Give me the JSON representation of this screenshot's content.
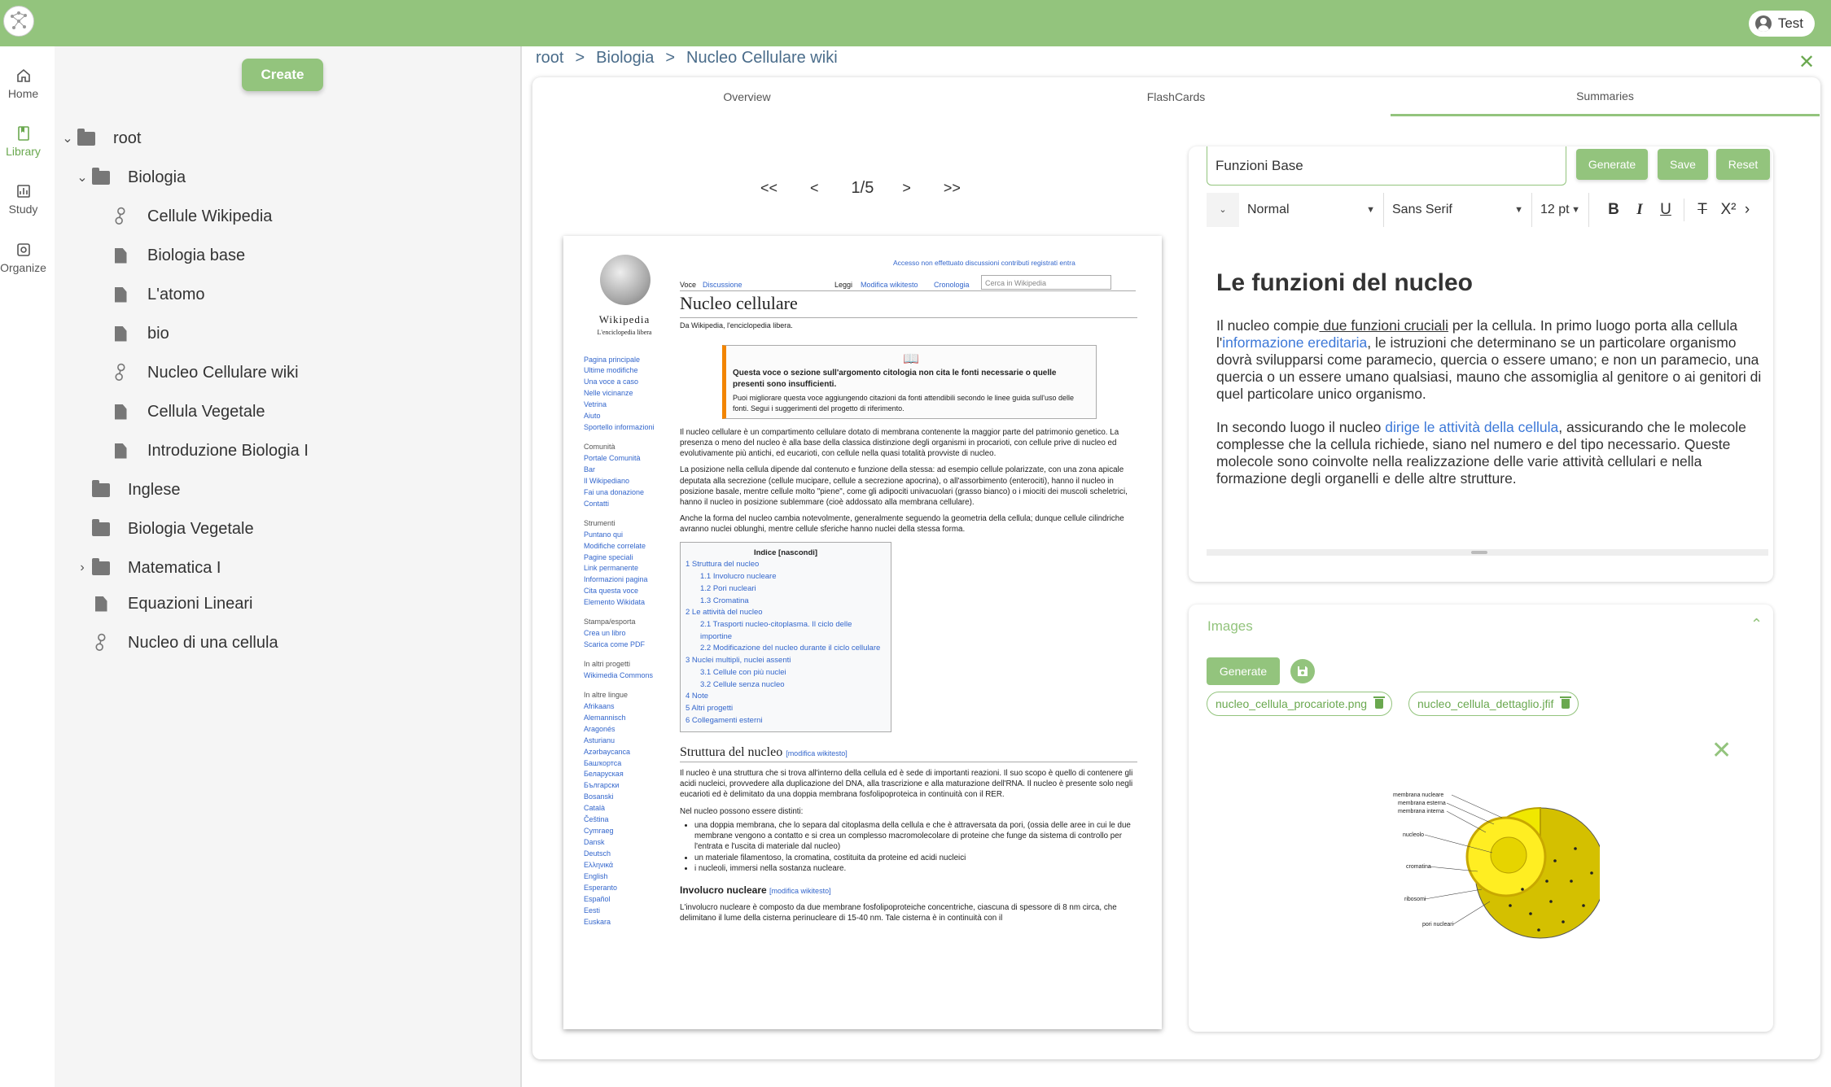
{
  "app": {
    "user_label": "Test"
  },
  "nav": [
    {
      "label": "Home",
      "icon": "home-icon"
    },
    {
      "label": "Library",
      "icon": "library-icon"
    },
    {
      "label": "Study",
      "icon": "study-icon"
    },
    {
      "label": "Organize",
      "icon": "organize-icon"
    }
  ],
  "sidebar": {
    "create_label": "Create",
    "tree": [
      {
        "label": "root",
        "type": "folder",
        "expanded": true
      },
      {
        "label": "Biologia",
        "type": "folder",
        "expanded": true
      },
      {
        "label": "Cellule Wikipedia",
        "type": "link"
      },
      {
        "label": "Biologia base",
        "type": "document"
      },
      {
        "label": "L'atomo",
        "type": "document"
      },
      {
        "label": "bio",
        "type": "document"
      },
      {
        "label": "Nucleo Cellulare wiki",
        "type": "link"
      },
      {
        "label": "Cellula Vegetale",
        "type": "document"
      },
      {
        "label": "Introduzione Biologia I",
        "type": "document"
      },
      {
        "label": "Inglese",
        "type": "folder"
      },
      {
        "label": "Biologia Vegetale",
        "type": "folder"
      },
      {
        "label": "Matematica I",
        "type": "folder",
        "expanded": false
      },
      {
        "label": "Equazioni Lineari",
        "type": "document"
      },
      {
        "label": "Nucleo di una cellula",
        "type": "link"
      }
    ]
  },
  "breadcrumb": {
    "items": [
      "root",
      "Biologia",
      "Nucleo Cellulare wiki"
    ],
    "separator": ">"
  },
  "tabs": [
    {
      "label": "Overview",
      "active": false
    },
    {
      "label": "FlashCards",
      "active": false
    },
    {
      "label": "Summaries",
      "active": true
    }
  ],
  "pager": {
    "first": "<<",
    "prev": "<",
    "current": "1/5",
    "next": ">",
    "last": ">>"
  },
  "document": {
    "top_links": "Accesso non effettuato  discussioni  contributi  registrati  entra",
    "tabs_left": [
      "Voce",
      "Discussione"
    ],
    "tabs_right": [
      "Leggi",
      "Modifica wikitesto",
      "Cronologia"
    ],
    "search_placeholder": "Cerca in Wikipedia",
    "logo_title": "Wikipedia",
    "logo_subtitle": "L'enciclopedia libera",
    "sidebar_links": [
      "Pagina principale",
      "Ultime modifiche",
      "Una voce a caso",
      "Nelle vicinanze",
      "Vetrina",
      "Aiuto",
      "Sportello informazioni"
    ],
    "sidebar_community_title": "Comunità",
    "sidebar_community": [
      "Portale Comunità",
      "Bar",
      "Il Wikipediano",
      "Fai una donazione",
      "Contatti"
    ],
    "sidebar_tools_title": "Strumenti",
    "sidebar_tools": [
      "Puntano qui",
      "Modifiche correlate",
      "Pagine speciali",
      "Link permanente",
      "Informazioni pagina",
      "Cita questa voce",
      "Elemento Wikidata"
    ],
    "sidebar_print_title": "Stampa/esporta",
    "sidebar_print": [
      "Crea un libro",
      "Scarica come PDF"
    ],
    "sidebar_projects_title": "In altri progetti",
    "sidebar_projects": [
      "Wikimedia Commons"
    ],
    "sidebar_lang_title": "In altre lingue",
    "sidebar_langs": [
      "Afrikaans",
      "Alemannisch",
      "Aragonés",
      "Asturianu",
      "Azərbaycanca",
      "Башҡортса",
      "Беларуская",
      "Български",
      "Bosanski",
      "Català",
      "Čeština",
      "Cymraeg",
      "Dansk",
      "Deutsch",
      "Ελληνικά",
      "English",
      "Esperanto",
      "Español",
      "Eesti",
      "Euskara"
    ],
    "title": "Nucleo cellulare",
    "from": "Da Wikipedia, l'enciclopedia libera.",
    "notice_bold": "Questa voce o sezione sull'argomento citologia non cita le fonti necessarie o quelle presenti sono insufficienti.",
    "notice_text": "Puoi migliorare questa voce aggiungendo citazioni da fonti attendibili secondo le linee guida sull'uso delle fonti. Segui i suggerimenti del progetto di riferimento.",
    "para1": "Il nucleo cellulare è un compartimento cellulare dotato di membrana contenente la maggior parte del patrimonio genetico. La presenza o meno del nucleo è alla base della classica distinzione degli organismi in procarioti, con cellule prive di nucleo ed evolutivamente più antichi, ed eucarioti, con cellule nella quasi totalità provviste di nucleo.",
    "para2": "La posizione nella cellula dipende dal contenuto e funzione della stessa: ad esempio cellule polarizzate, con una zona apicale deputata alla secrezione (cellule mucipare, cellule a secrezione apocrina), o all'assorbimento (enterociti), hanno il nucleo in posizione basale, mentre cellule molto \"piene\", come gli adipociti univacuolari (grasso bianco) o i miociti dei muscoli scheletrici, hanno il nucleo in posizione sublemmare (cioè addossato alla membrana cellulare).",
    "para3": "Anche la forma del nucleo cambia notevolmente, generalmente seguendo la geometria della cellula; dunque cellule cilindriche avranno nuclei oblunghi, mentre cellule sferiche hanno nuclei della stessa forma.",
    "toc_title": "Indice [nascondi]",
    "toc": [
      "1 Struttura del nucleo",
      "1.1 Involucro nucleare",
      "1.2 Pori nucleari",
      "1.3 Cromatina",
      "2 Le attività del nucleo",
      "2.1 Trasporti nucleo-citoplasma. Il ciclo delle importine",
      "2.2 Modificazione del nucleo durante il ciclo cellulare",
      "3 Nuclei multipli, nuclei assenti",
      "3.1 Cellule con più nuclei",
      "3.2 Cellule senza nucleo",
      "4 Note",
      "5 Altri progetti",
      "6 Collegamenti esterni"
    ],
    "section1": "Struttura del nucleo",
    "section1_edit": "[modifica wikitesto]",
    "para4": "Il nucleo è una struttura che si trova all'interno della cellula ed è sede di importanti reazioni. Il suo scopo è quello di contenere gli acidi nucleici, provvedere alla duplicazione del DNA, alla trascrizione e alla maturazione dell'RNA. Il nucleo è presente solo negli eucarioti ed è delimitato da una doppia membrana fosfolipoproteica in continuità con il RER.",
    "para5": "Nel nucleo possono essere distinti:",
    "bullets": [
      "una doppia membrana, che lo separa dal citoplasma della cellula e che è attraversata da pori, (ossia delle aree in cui le due membrane vengono a contatto e si crea un complesso macromolecolare di proteine che funge da sistema di controllo per l'entrata e l'uscita di materiale dal nucleo)",
      "un materiale filamentoso, la cromatina, costituita da proteine ed acidi nucleici",
      "i nucleoli, immersi nella sostanza nucleare."
    ],
    "section2": "Involucro nucleare",
    "section2_edit": "[modifica wikitesto]",
    "para6": "L'involucro nucleare è composto da due membrane fosfolipoproteiche concentriche, ciascuna di spessore di 8 nm circa, che delimitano il lume della cisterna perinucleare di 15-40 nm. Tale cisterna è in continuità con il"
  },
  "editor": {
    "title_value": "Funzioni Base",
    "generate_label": "Generate",
    "save_label": "Save",
    "reset_label": "Reset",
    "style_select": "Normal",
    "font_select": "Sans Serif",
    "size_select": "12 pt",
    "heading": "Le funzioni del nucleo",
    "p1_a": "Il nucleo compie",
    "p1_link1": " due funzioni cruciali",
    "p1_b": " per la cellula. In primo luogo porta alla cellula l'",
    "p1_link2": "informazione ereditaria",
    "p1_c": ", le istruzioni che determinano se un particolare organismo dovrà svilupparsi come paramecio, quercia o essere umano; e non un paramecio, una quercia o un essere umano qualsiasi, mauno che assomiglia al genitore o ai genitori di quel particolare unico organismo.",
    "p2_a": "In secondo luogo il nucleo ",
    "p2_link": "dirige le attività della cellula",
    "p2_b": ", assicurando che le molecole complesse che la cellula richiede, siano nel numero e del tipo necessario. Queste molecole sono coinvolte nella realizzazione delle varie attività cellulari e nella formazione degli organelli e delle altre strutture."
  },
  "images": {
    "title": "Images",
    "generate_label": "Generate",
    "files": [
      "nucleo_cellula_procariote.png",
      "nucleo_cellula_dettaglio.jfif"
    ],
    "diagram_labels": [
      "membrana nucleare",
      "membrana esterna",
      "membrana interna",
      "nucleolo",
      "cromatina",
      "ribosomi",
      "pori nucleari"
    ]
  },
  "colors": {
    "accent": "#93c47d",
    "accent_dark": "#6aa84f",
    "link": "#3c78d8",
    "breadcrumb": "#4a6c8a"
  }
}
